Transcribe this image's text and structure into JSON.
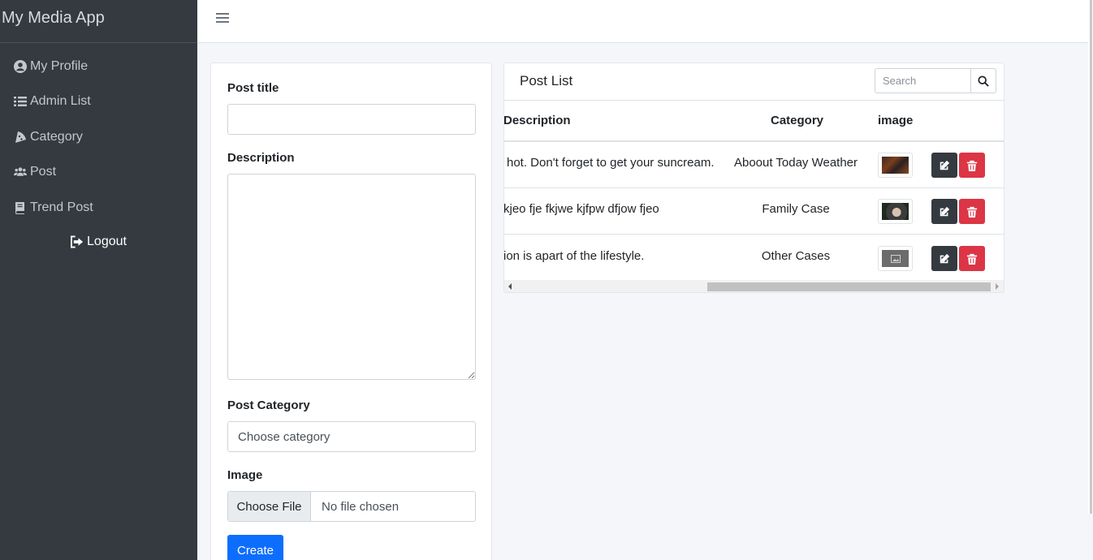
{
  "app": {
    "title": "My Media App"
  },
  "sidebar": {
    "items": [
      {
        "label": "My Profile",
        "icon": "user-circle-icon"
      },
      {
        "label": "Admin List",
        "icon": "list-icon"
      },
      {
        "label": "Category",
        "icon": "pizza-slice-icon"
      },
      {
        "label": "Post",
        "icon": "users-icon"
      },
      {
        "label": "Trend Post",
        "icon": "book-icon"
      }
    ],
    "logout": "Logout"
  },
  "form": {
    "title_label": "Post title",
    "title_value": "",
    "description_label": "Description",
    "description_value": "",
    "category_label": "Post Category",
    "category_selected": "Choose category",
    "image_label": "Image",
    "file_button": "Choose File",
    "file_status": "No file chosen",
    "create_label": "Create"
  },
  "post_list": {
    "title": "Post List",
    "search_placeholder": "Search",
    "columns": [
      "Description",
      "Category",
      "image"
    ],
    "rows": [
      {
        "description": "hot. Don't forget to get your suncream.",
        "category": "Aboout Today Weather"
      },
      {
        "description": "kjeo fje fkjwe kjfpw dfjow fjeo",
        "category": "Family Case"
      },
      {
        "description": "ion is apart of the lifestyle.",
        "category": "Other Cases"
      }
    ]
  },
  "colors": {
    "sidebar_bg": "#343a40",
    "primary": "#0d6efd",
    "danger": "#dc3545",
    "dark": "#343a40"
  }
}
